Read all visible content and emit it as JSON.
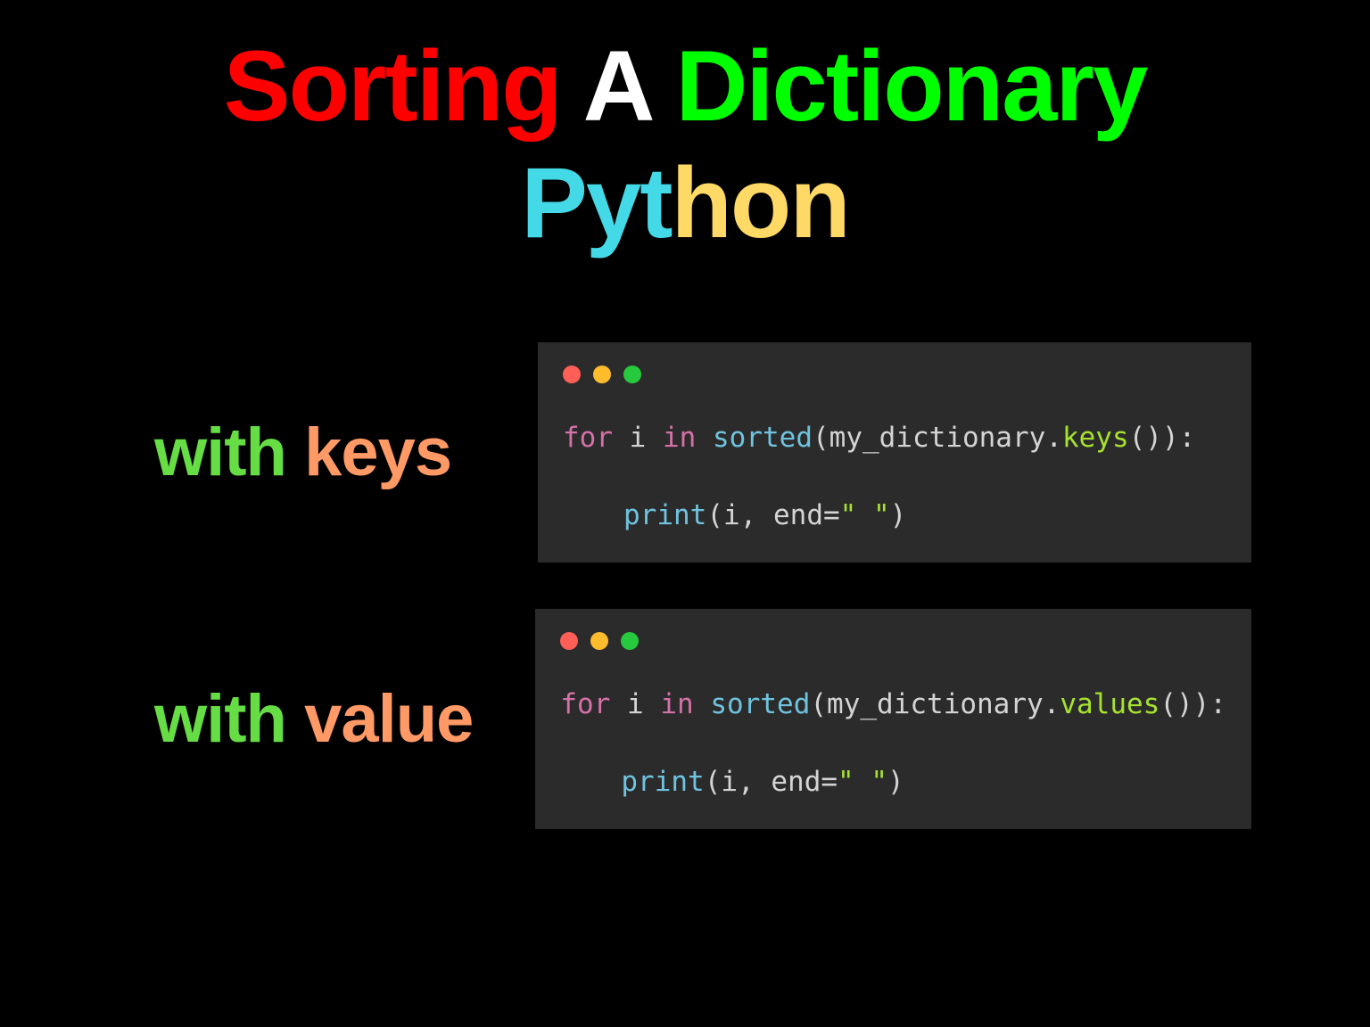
{
  "title": {
    "word1": "Sorting",
    "word2": "A",
    "word3": "Dictionary",
    "word4_part1": "Pyt",
    "word4_part2": "hon"
  },
  "rows": [
    {
      "label_part1": "with ",
      "label_part2": "keys",
      "code": {
        "kw_for": "for",
        "var": "i",
        "kw_in": "in",
        "fn_sorted": "sorted",
        "obj": "my_dictionary",
        "method": "keys",
        "fn_print": "print",
        "print_arg1": "i",
        "print_kw": "end",
        "print_val": "\" \""
      }
    },
    {
      "label_part1": "with ",
      "label_part2": "value",
      "code": {
        "kw_for": "for",
        "var": "i",
        "kw_in": "in",
        "fn_sorted": "sorted",
        "obj": "my_dictionary",
        "method": "values",
        "fn_print": "print",
        "print_arg1": "i",
        "print_kw": "end",
        "print_val": "\" \""
      }
    }
  ]
}
